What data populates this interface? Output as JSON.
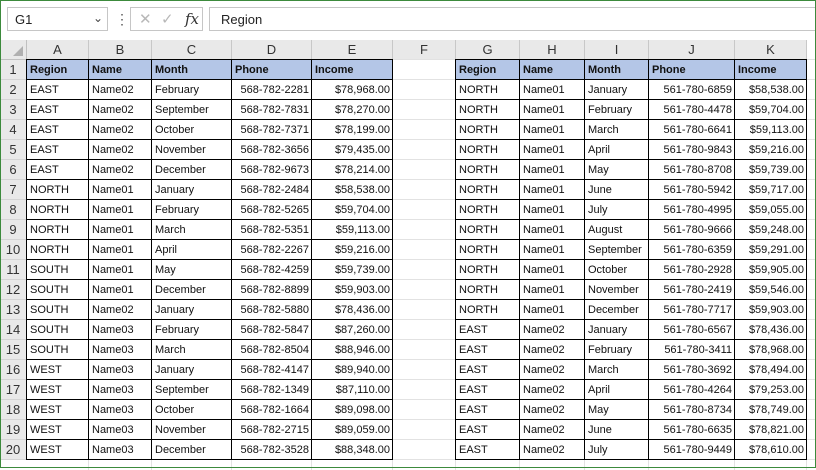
{
  "formula_bar": {
    "name_box": "G1",
    "formula": "Region",
    "cancel_glyph": "✕",
    "enter_glyph": "✓",
    "fx_label": "fx",
    "dots": "⋮",
    "chevron": "⌄"
  },
  "columns": [
    "A",
    "B",
    "C",
    "D",
    "E",
    "F",
    "G",
    "H",
    "I",
    "J",
    "K"
  ],
  "rows": [
    "1",
    "2",
    "3",
    "4",
    "5",
    "6",
    "7",
    "8",
    "9",
    "10",
    "11",
    "12",
    "13",
    "14",
    "15",
    "16",
    "17",
    "18",
    "19",
    "20"
  ],
  "colors": {
    "header_fill": "#b4c6e7",
    "frame": "#3c8a3c"
  },
  "table_left": {
    "headers": [
      "Region",
      "Name",
      "Month",
      "Phone",
      "Income"
    ],
    "rows": [
      [
        "EAST",
        "Name02",
        "February",
        "568-782-2281",
        "$78,968.00"
      ],
      [
        "EAST",
        "Name02",
        "September",
        "568-782-7831",
        "$78,270.00"
      ],
      [
        "EAST",
        "Name02",
        "October",
        "568-782-7371",
        "$78,199.00"
      ],
      [
        "EAST",
        "Name02",
        "November",
        "568-782-3656",
        "$79,435.00"
      ],
      [
        "EAST",
        "Name02",
        "December",
        "568-782-9673",
        "$78,214.00"
      ],
      [
        "NORTH",
        "Name01",
        "January",
        "568-782-2484",
        "$58,538.00"
      ],
      [
        "NORTH",
        "Name01",
        "February",
        "568-782-5265",
        "$59,704.00"
      ],
      [
        "NORTH",
        "Name01",
        "March",
        "568-782-5351",
        "$59,113.00"
      ],
      [
        "NORTH",
        "Name01",
        "April",
        "568-782-2267",
        "$59,216.00"
      ],
      [
        "SOUTH",
        "Name01",
        "May",
        "568-782-4259",
        "$59,739.00"
      ],
      [
        "SOUTH",
        "Name01",
        "December",
        "568-782-8899",
        "$59,903.00"
      ],
      [
        "SOUTH",
        "Name02",
        "January",
        "568-782-5880",
        "$78,436.00"
      ],
      [
        "SOUTH",
        "Name03",
        "February",
        "568-782-5847",
        "$87,260.00"
      ],
      [
        "SOUTH",
        "Name03",
        "March",
        "568-782-8504",
        "$88,946.00"
      ],
      [
        "WEST",
        "Name03",
        "January",
        "568-782-4147",
        "$89,940.00"
      ],
      [
        "WEST",
        "Name03",
        "September",
        "568-782-1349",
        "$87,110.00"
      ],
      [
        "WEST",
        "Name03",
        "October",
        "568-782-1664",
        "$89,098.00"
      ],
      [
        "WEST",
        "Name03",
        "November",
        "568-782-2715",
        "$89,059.00"
      ],
      [
        "WEST",
        "Name03",
        "December",
        "568-782-3528",
        "$88,348.00"
      ]
    ]
  },
  "table_right": {
    "headers": [
      "Region",
      "Name",
      "Month",
      "Phone",
      "Income"
    ],
    "rows": [
      [
        "NORTH",
        "Name01",
        "January",
        "561-780-6859",
        "$58,538.00"
      ],
      [
        "NORTH",
        "Name01",
        "February",
        "561-780-4478",
        "$59,704.00"
      ],
      [
        "NORTH",
        "Name01",
        "March",
        "561-780-6641",
        "$59,113.00"
      ],
      [
        "NORTH",
        "Name01",
        "April",
        "561-780-9843",
        "$59,216.00"
      ],
      [
        "NORTH",
        "Name01",
        "May",
        "561-780-8708",
        "$59,739.00"
      ],
      [
        "NORTH",
        "Name01",
        "June",
        "561-780-5942",
        "$59,717.00"
      ],
      [
        "NORTH",
        "Name01",
        "July",
        "561-780-4995",
        "$59,055.00"
      ],
      [
        "NORTH",
        "Name01",
        "August",
        "561-780-9666",
        "$59,248.00"
      ],
      [
        "NORTH",
        "Name01",
        "September",
        "561-780-6359",
        "$59,291.00"
      ],
      [
        "NORTH",
        "Name01",
        "October",
        "561-780-2928",
        "$59,905.00"
      ],
      [
        "NORTH",
        "Name01",
        "November",
        "561-780-2419",
        "$59,546.00"
      ],
      [
        "NORTH",
        "Name01",
        "December",
        "561-780-7717",
        "$59,903.00"
      ],
      [
        "EAST",
        "Name02",
        "January",
        "561-780-6567",
        "$78,436.00"
      ],
      [
        "EAST",
        "Name02",
        "February",
        "561-780-3411",
        "$78,968.00"
      ],
      [
        "EAST",
        "Name02",
        "March",
        "561-780-3692",
        "$78,494.00"
      ],
      [
        "EAST",
        "Name02",
        "April",
        "561-780-4264",
        "$79,253.00"
      ],
      [
        "EAST",
        "Name02",
        "May",
        "561-780-8734",
        "$78,749.00"
      ],
      [
        "EAST",
        "Name02",
        "June",
        "561-780-6635",
        "$78,821.00"
      ],
      [
        "EAST",
        "Name02",
        "July",
        "561-780-9449",
        "$78,610.00"
      ]
    ]
  }
}
